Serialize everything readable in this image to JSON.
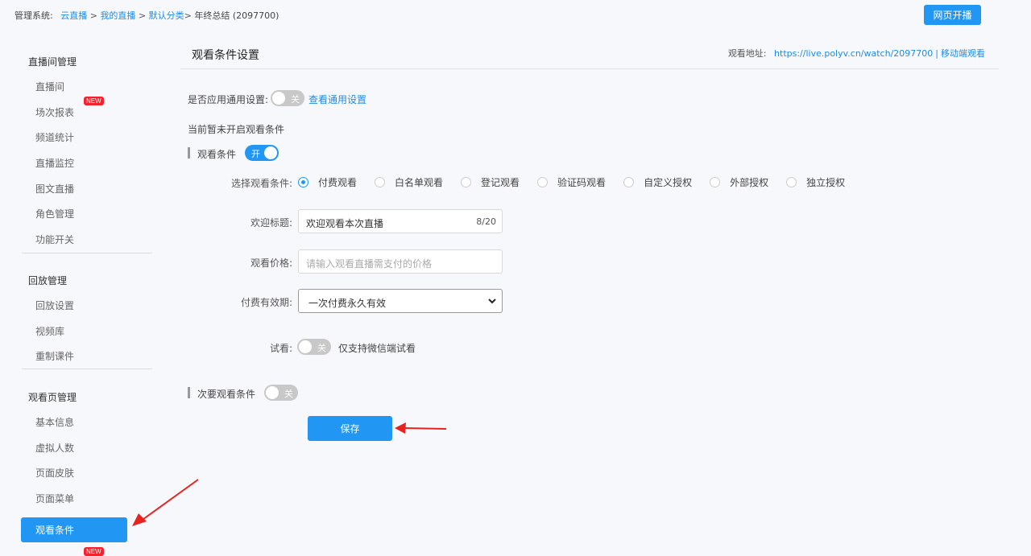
{
  "breadcrumb": {
    "prefix": "管理系统:",
    "items": [
      "云直播",
      "我的直播",
      "默认分类"
    ],
    "current": "年终总结 (2097700)"
  },
  "header": {
    "live_button": "网页开播"
  },
  "sidebar": {
    "group1": "直播间管理",
    "group1_items": [
      "直播间",
      "场次报表",
      "频道统计",
      "直播监控",
      "图文直播",
      "角色管理",
      "功能开关"
    ],
    "group2": "回放管理",
    "group2_items": [
      "回放设置",
      "视频库",
      "重制课件"
    ],
    "group3": "观看页管理",
    "group3_items": [
      "基本信息",
      "虚拟人数",
      "页面皮肤",
      "页面菜单"
    ],
    "active_item": "观看条件",
    "new_badge": "NEW"
  },
  "main": {
    "title": "观看条件设置",
    "watch_address_label": "观看地址:",
    "watch_url": "https://live.polyv.cn/watch/2097700",
    "mobile_link": "移动端观看",
    "apply_common_label": "是否应用通用设置:",
    "apply_common_toggle": "关",
    "view_common_link": "查看通用设置",
    "not_enabled_text": "当前暂未开启观看条件",
    "condition_section": "观看条件",
    "condition_toggle": "开",
    "select_label": "选择观看条件:",
    "options": [
      "付费观看",
      "白名单观看",
      "登记观看",
      "验证码观看",
      "自定义授权",
      "外部授权",
      "独立授权"
    ],
    "selected_option": "付费观看",
    "welcome_label": "欢迎标题:",
    "welcome_value": "欢迎观看本次直播",
    "welcome_count": "8/20",
    "price_label": "观看价格:",
    "price_placeholder": "请输入观看直播需支付的价格",
    "validity_label": "付费有效期:",
    "validity_value": "一次付费永久有效",
    "trial_label": "试看:",
    "trial_toggle": "关",
    "trial_note": "仅支持微信端试看",
    "secondary_section": "次要观看条件",
    "secondary_toggle": "关",
    "save_button": "保存"
  },
  "colors": {
    "accent": "#2196f3",
    "link": "#1e8ce6",
    "badge": "#f5222d",
    "annotation_arrow": "#e8231f"
  }
}
